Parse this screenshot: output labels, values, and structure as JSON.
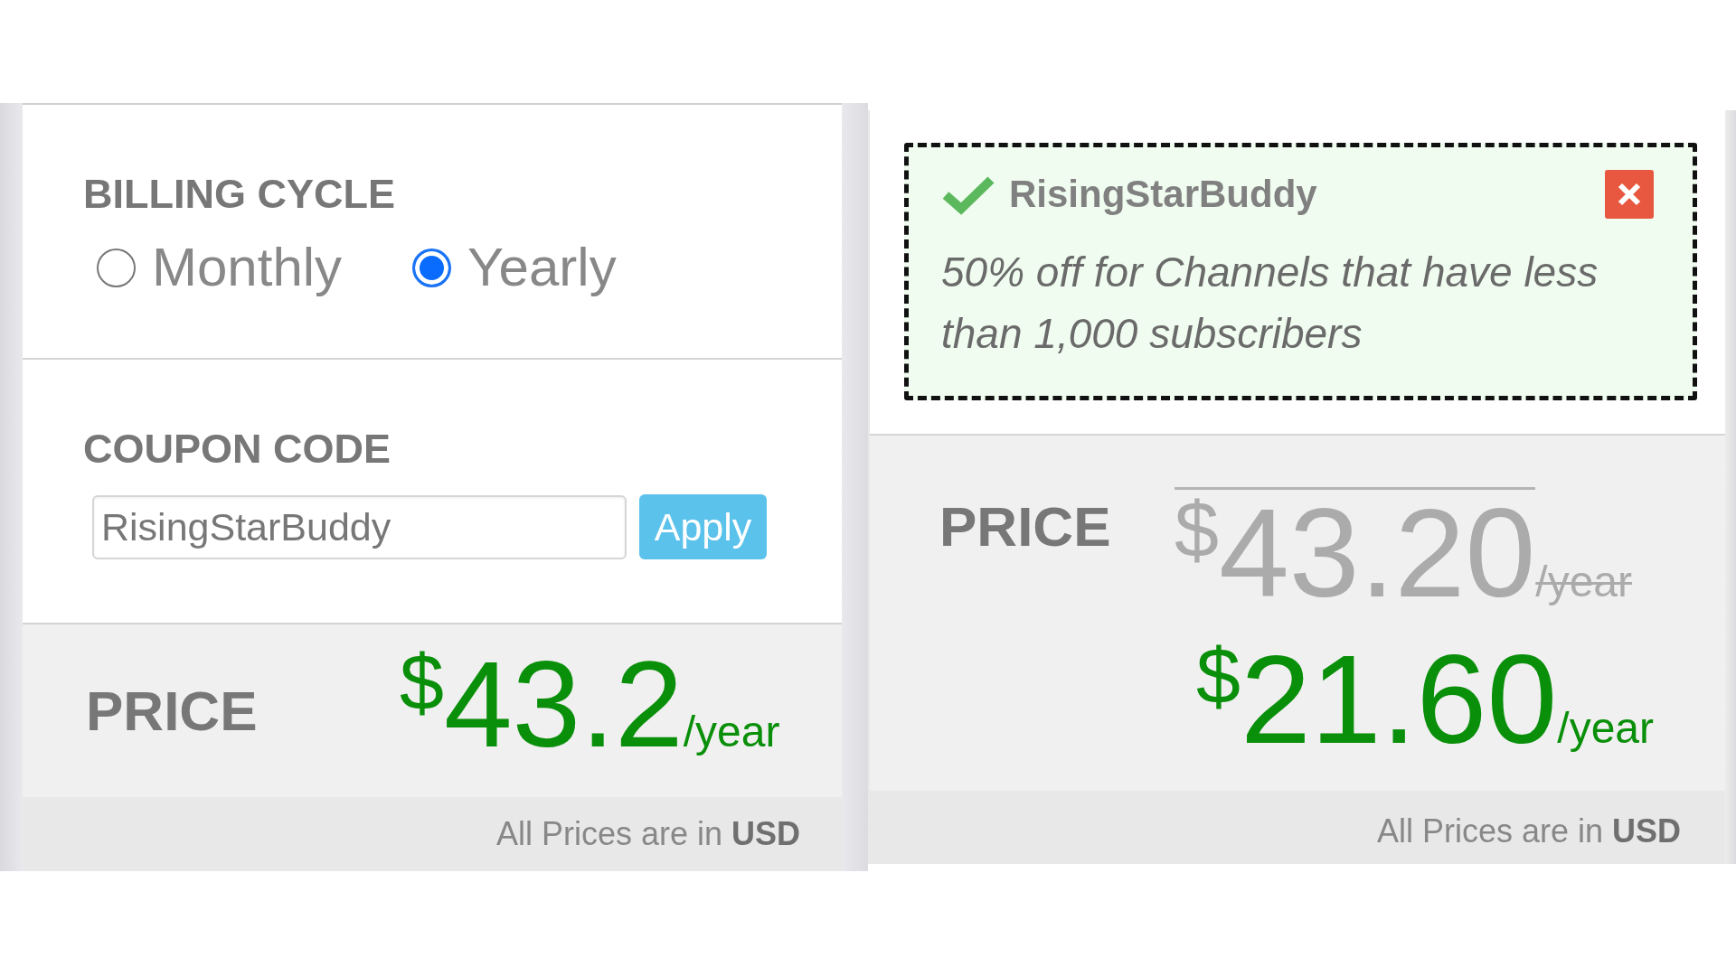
{
  "billing_panel": {
    "billing_cycle": {
      "label": "BILLING CYCLE",
      "options": [
        {
          "label": "Monthly",
          "selected": false
        },
        {
          "label": "Yearly",
          "selected": true
        }
      ]
    },
    "coupon": {
      "label": "COUPON CODE",
      "value": "RisingStarBuddy",
      "button": "Apply"
    },
    "price": {
      "label": "PRICE",
      "currency": "$",
      "amount": "43.2",
      "period": "/year"
    },
    "footer_note": "All Prices are in **USD**"
  },
  "applied_panel": {
    "coupon_notice": {
      "code": "RisingStarBuddy",
      "description": "50% off for Channels that have less than 1,000 subscribers"
    },
    "price": {
      "label": "PRICE",
      "original": {
        "currency": "$",
        "amount": "43.20",
        "period": "/year",
        "struck": true
      },
      "discounted": {
        "currency": "$",
        "amount": "21.60",
        "period": "/year"
      }
    },
    "footer_note": "All Prices are in **USD**"
  }
}
